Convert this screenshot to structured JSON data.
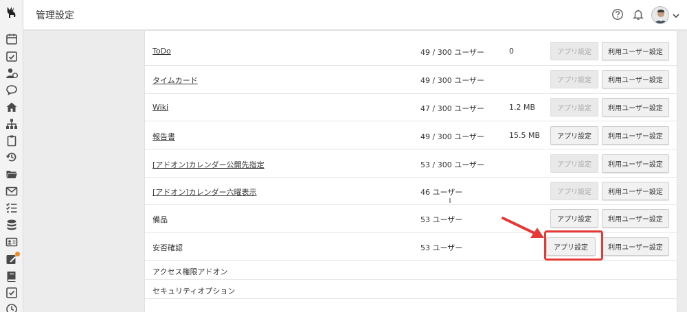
{
  "header": {
    "title": "管理設定"
  },
  "rail_icons": [
    "logo-icon",
    "calendar-icon",
    "task-check-icon",
    "user-clock-icon",
    "chat-bubble-icon",
    "home-icon",
    "org-chart-icon",
    "clipboard-icon",
    "history-icon",
    "folder-icon",
    "mail-icon",
    "checklist-icon",
    "database-icon",
    "id-card-icon",
    "edit-note-icon",
    "book-icon",
    "checkbox-icon",
    "clock-icon"
  ],
  "apps": [
    {
      "name": "ToDo",
      "link": true,
      "users": "49 / 300 ユーザー",
      "size": "0",
      "app_settings": "アプリ設定",
      "app_enabled": false,
      "user_settings": "利用ユーザー設定"
    },
    {
      "name": "タイムカード",
      "link": true,
      "users": "49 / 300 ユーザー",
      "size": "",
      "app_settings": "アプリ設定",
      "app_enabled": false,
      "user_settings": "利用ユーザー設定"
    },
    {
      "name": "Wiki",
      "link": true,
      "users": "47 / 300 ユーザー",
      "size": "1.2 MB",
      "app_settings": "アプリ設定",
      "app_enabled": false,
      "user_settings": "利用ユーザー設定"
    },
    {
      "name": "報告書",
      "link": true,
      "users": "49 / 300 ユーザー",
      "size": "15.5 MB",
      "app_settings": "アプリ設定",
      "app_enabled": true,
      "user_settings": "利用ユーザー設定"
    },
    {
      "name": "[アドオン]カレンダー公開先指定",
      "link": true,
      "users": "53 / 300 ユーザー",
      "size": "",
      "app_settings": "アプリ設定",
      "app_enabled": false,
      "user_settings": "利用ユーザー設定"
    },
    {
      "name": "[アドオン]カレンダー六曜表示",
      "link": true,
      "users": "46 ユーザー",
      "size": "",
      "app_settings": "アプリ設定",
      "app_enabled": false,
      "user_settings": "利用ユーザー設定"
    },
    {
      "name": "備品",
      "link": false,
      "users": "53 ユーザー",
      "size": "",
      "app_settings": "アプリ設定",
      "app_enabled": true,
      "user_settings": "利用ユーザー設定"
    },
    {
      "name": "安否確認",
      "link": false,
      "users": "53 ユーザー",
      "size": "",
      "app_settings": "アプリ設定",
      "app_enabled": true,
      "user_settings": "利用ユーザー設定"
    }
  ],
  "options": [
    {
      "name": "アクセス権限アドオン"
    },
    {
      "name": "セキュリティオプション"
    }
  ],
  "colors": {
    "highlight": "#e53935",
    "notification_dot": "#f08a24"
  }
}
